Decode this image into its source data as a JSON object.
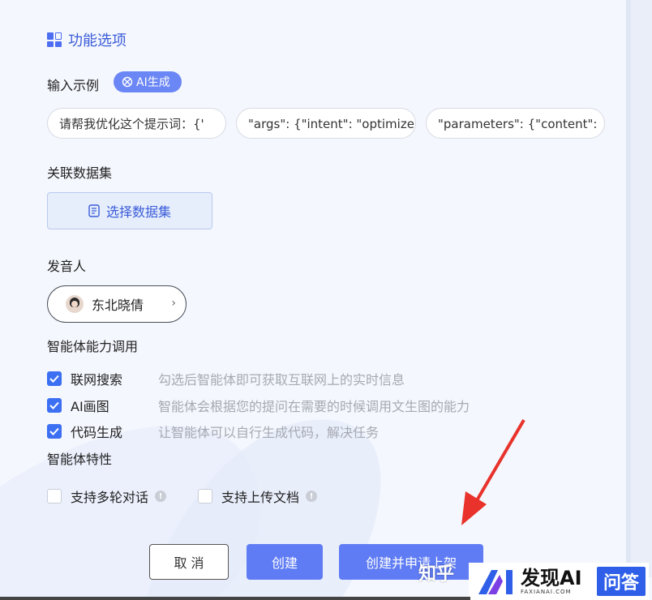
{
  "section": {
    "title": "功能选项",
    "icon": "grid-icon"
  },
  "examples": {
    "label": "输入示例",
    "ai_badge": "AI生成",
    "items": [
      "请帮我优化这个提示词：{'",
      "\"args\": {\"intent\": \"optimize",
      "\"parameters\": {\"content\":"
    ]
  },
  "dataset": {
    "label": "关联数据集",
    "button": "选择数据集"
  },
  "speaker": {
    "label": "发音人",
    "name": "东北晓倩"
  },
  "capabilities": {
    "label": "智能体能力调用",
    "items": [
      {
        "name": "联网搜索",
        "desc": "勾选后智能体即可获取互联网上的实时信息",
        "checked": true
      },
      {
        "name": "AI画图",
        "desc": "智能体会根据您的提问在需要的时候调用文生图的能力",
        "checked": true
      },
      {
        "name": "代码生成",
        "desc": "让智能体可以自行生成代码，解决任务",
        "checked": true
      }
    ]
  },
  "traits": {
    "label": "智能体特性",
    "items": [
      {
        "name": "支持多轮对话",
        "checked": false
      },
      {
        "name": "支持上传文档",
        "checked": false
      }
    ]
  },
  "actions": {
    "cancel": "取 消",
    "create": "创建",
    "create_apply": "创建并申请上架"
  },
  "watermark": {
    "zhihu": "知乎",
    "brand": "发现AI",
    "brand_sub": "FAXIANAI.COM",
    "qa": "问答"
  },
  "colors": {
    "accent": "#4e6ef2",
    "primary_button": "#5f7cf4",
    "checkbox": "#3c6ff2",
    "arrow": "#e8322b"
  }
}
